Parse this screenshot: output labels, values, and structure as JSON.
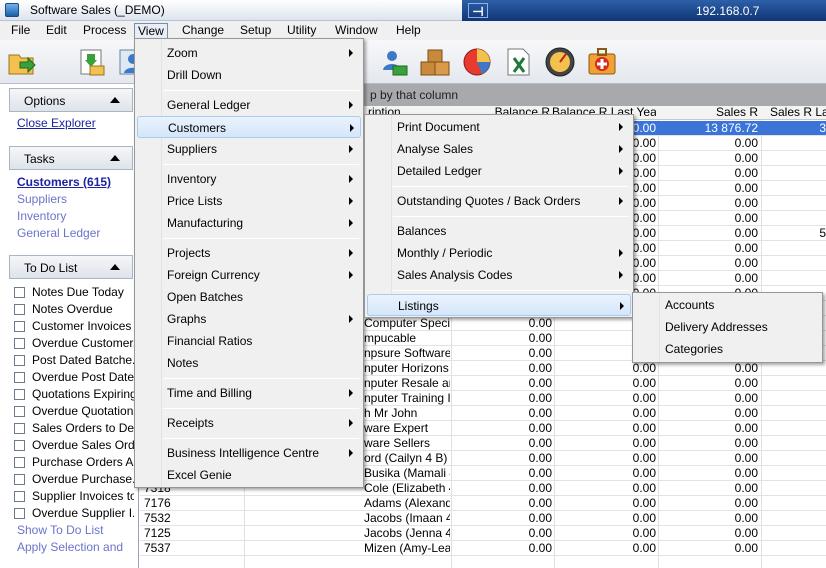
{
  "window": {
    "title": "Software Sales (_DEMO)",
    "remote_ip": "192.168.0.7"
  },
  "menubar": [
    "File",
    "Edit",
    "Process",
    "View",
    "Change",
    "Setup",
    "Utility",
    "Window",
    "Help"
  ],
  "explorer": {
    "options": {
      "title": "Options",
      "links": [
        "Close Explorer"
      ]
    },
    "tasks": {
      "title": "Tasks",
      "links": [
        "Customers (615)",
        "Suppliers",
        "Inventory",
        "General Ledger"
      ]
    },
    "todo": {
      "title": "To Do List",
      "items": [
        "Notes Due Today",
        "Notes Overdue",
        "Customer Invoices ...",
        "Overdue Customer...",
        "Post Dated Batche...",
        "Overdue Post Date...",
        "Quotations Expiring...",
        "Overdue Quotations",
        "Sales Orders to De...",
        "Overdue Sales Orders",
        "Purchase Orders A...",
        "Overdue Purchase...",
        "Supplier Invoices to...",
        "Overdue Supplier I..."
      ],
      "links": [
        "Show To Do List",
        "Apply Selection and"
      ]
    }
  },
  "grid": {
    "group_hint": "p by that column",
    "headers": [
      "ription",
      "Balance R",
      "Balance R Last Year",
      "Sales R",
      "Sales R La"
    ],
    "rows": [
      {
        "code": "",
        "name": "",
        "bal": "",
        "bly": "0.00",
        "sales": "13 876.72",
        "sly": "3",
        "sel": true
      },
      {
        "code": "",
        "name": "",
        "bal": "",
        "bly": "0.00",
        "sales": "0.00",
        "sly": ""
      },
      {
        "code": "",
        "name": "",
        "bal": "",
        "bly": "0.00",
        "sales": "0.00",
        "sly": ""
      },
      {
        "code": "",
        "name": "",
        "bal": "",
        "bly": "0.00",
        "sales": "0.00",
        "sly": ""
      },
      {
        "code": "",
        "name": "",
        "bal": "",
        "bly": "0.00",
        "sales": "0.00",
        "sly": ""
      },
      {
        "code": "",
        "name": "",
        "bal": "",
        "bly": "0.00",
        "sales": "0.00",
        "sly": ""
      },
      {
        "code": "",
        "name": "",
        "bal": "",
        "bly": "0.00",
        "sales": "0.00",
        "sly": ""
      },
      {
        "code": "",
        "name": "",
        "bal": "",
        "bly": "0.00",
        "sales": "0.00",
        "sly": "5"
      },
      {
        "code": "",
        "name": "",
        "bal": "",
        "bly": "0.00",
        "sales": "0.00",
        "sly": ""
      },
      {
        "code": "",
        "name": "",
        "bal": "",
        "bly": "0.00",
        "sales": "0.00",
        "sly": ""
      },
      {
        "code": "",
        "name": "",
        "bal": "",
        "bly": "0.00",
        "sales": "0.00",
        "sly": ""
      },
      {
        "code": "",
        "name": "",
        "bal": "",
        "bly": "0.00",
        "sales": "0.00",
        "sly": ""
      },
      {
        "code": "",
        "name": "H SALES ACCO",
        "bal": "0.00",
        "bly": "",
        "sales": "",
        "sly": ""
      },
      {
        "code": "",
        "name": "Computer Specia",
        "bal": "0.00",
        "bly": "",
        "sales": "",
        "sly": ""
      },
      {
        "code": "",
        "name": "mpucable",
        "bal": "0.00",
        "bly": "",
        "sales": "",
        "sly": ""
      },
      {
        "code": "",
        "name": "npsure Software",
        "bal": "0.00",
        "bly": "0.00",
        "sales": "0.00",
        "sly": ""
      },
      {
        "code": "",
        "name": "nputer Horizons",
        "bal": "0.00",
        "bly": "0.00",
        "sales": "0.00",
        "sly": ""
      },
      {
        "code": "",
        "name": "nputer Resale and",
        "bal": "0.00",
        "bly": "0.00",
        "sales": "0.00",
        "sly": ""
      },
      {
        "code": "",
        "name": "nputer Training In",
        "bal": "0.00",
        "bly": "0.00",
        "sales": "0.00",
        "sly": ""
      },
      {
        "code": "",
        "name": "h Mr John",
        "bal": "0.00",
        "bly": "0.00",
        "sales": "0.00",
        "sly": ""
      },
      {
        "code": "",
        "name": "ware Expert",
        "bal": "0.00",
        "bly": "0.00",
        "sales": "0.00",
        "sly": ""
      },
      {
        "code": "",
        "name": "ware Sellers",
        "bal": "0.00",
        "bly": "0.00",
        "sales": "0.00",
        "sly": ""
      },
      {
        "code": "",
        "name": "ord (Cailyn 4 B)",
        "bal": "0.00",
        "bly": "0.00",
        "sales": "0.00",
        "sly": ""
      },
      {
        "code": "7413",
        "name": "Busika (Mamali 4 C)",
        "bal": "0.00",
        "bly": "0.00",
        "sales": "0.00",
        "sly": ""
      },
      {
        "code": "7318",
        "name": "Cole (Elizabeth 4 A)",
        "bal": "0.00",
        "bly": "0.00",
        "sales": "0.00",
        "sly": ""
      },
      {
        "code": "7176",
        "name": "Adams (Alexandra 4...",
        "bal": "0.00",
        "bly": "0.00",
        "sales": "0.00",
        "sly": ""
      },
      {
        "code": "7532",
        "name": "Jacobs (Imaan 4 B / ...",
        "bal": "0.00",
        "bly": "0.00",
        "sales": "0.00",
        "sly": ""
      },
      {
        "code": "7125",
        "name": "Jacobs (Jenna 4 B / ...",
        "bal": "0.00",
        "bly": "0.00",
        "sales": "0.00",
        "sly": ""
      },
      {
        "code": "7537",
        "name": "Mizen (Amy-Lea 4 B / ...",
        "bal": "0.00",
        "bly": "0.00",
        "sales": "0.00",
        "sly": ""
      }
    ]
  },
  "view_menu": {
    "items": [
      "Zoom",
      "Drill Down",
      "General Ledger",
      "Customers",
      "Suppliers",
      "Inventory",
      "Price Lists",
      "Manufacturing",
      "Projects",
      "Foreign Currency",
      "Open Batches",
      "Graphs",
      "Financial Ratios",
      "Notes",
      "Time and Billing",
      "Receipts",
      "Business Intelligence Centre",
      "Excel Genie"
    ]
  },
  "customers_menu": {
    "items": [
      "Print Document",
      "Analyse Sales",
      "Detailed Ledger",
      "Outstanding Quotes / Back Orders",
      "Balances",
      "Monthly / Periodic",
      "Sales Analysis Codes",
      "Listings"
    ]
  },
  "listings_menu": {
    "items": [
      "Accounts",
      "Delivery Addresses",
      "Categories"
    ]
  },
  "toolbar_icons": [
    "export-icon",
    "download-icon",
    "user-icon",
    "user-download-icon",
    "boxes-icon",
    "pie-chart-icon",
    "excel-icon",
    "gauge-icon",
    "first-aid-icon"
  ]
}
